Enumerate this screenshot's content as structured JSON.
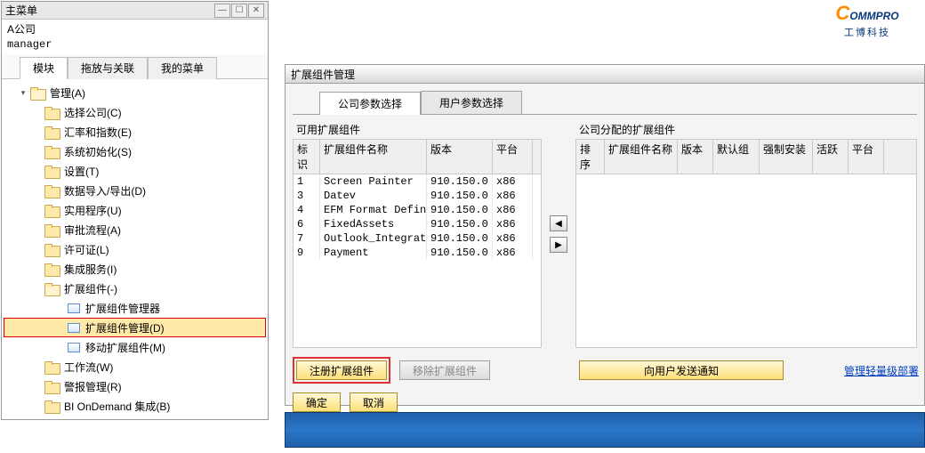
{
  "main_menu": {
    "title": "主菜单",
    "company": "A公司",
    "user": "manager",
    "tabs": [
      "模块",
      "拖放与关联",
      "我的菜单"
    ],
    "root": "管理(A)",
    "items": [
      "选择公司(C)",
      "汇率和指数(E)",
      "系统初始化(S)",
      "设置(T)",
      "数据导入/导出(D)",
      "实用程序(U)",
      "审批流程(A)",
      "许可证(L)",
      "集成服务(I)",
      "扩展组件(-)",
      "工作流(W)",
      "警报管理(R)",
      "BI OnDemand 集成(B)"
    ],
    "ext_children": [
      "扩展组件管理器",
      "扩展组件管理(D)",
      "移动扩展组件(M)"
    ]
  },
  "content": {
    "title": "扩展组件管理",
    "tabs": [
      "公司参数选择",
      "用户参数选择"
    ],
    "left": {
      "title": "可用扩展组件",
      "headers": [
        "标识",
        "扩展组件名称",
        "版本",
        "平台"
      ],
      "rows": [
        {
          "id": "1",
          "name": "Screen Painter",
          "ver": "910.150.0",
          "plat": "x86"
        },
        {
          "id": "3",
          "name": "Datev",
          "ver": "910.150.0",
          "plat": "x86"
        },
        {
          "id": "4",
          "name": "EFM Format Defini",
          "ver": "910.150.0",
          "plat": "x86"
        },
        {
          "id": "6",
          "name": "FixedAssets",
          "ver": "910.150.0",
          "plat": "x86"
        },
        {
          "id": "7",
          "name": "Outlook_Integrati",
          "ver": "910.150.0",
          "plat": "x86"
        },
        {
          "id": "9",
          "name": "Payment",
          "ver": "910.150.0",
          "plat": "x86"
        }
      ]
    },
    "right": {
      "title": "公司分配的扩展组件",
      "headers": [
        "排序",
        "扩展组件名称",
        "版本",
        "默认组",
        "强制安装",
        "活跃",
        "平台"
      ]
    },
    "buttons": {
      "register": "注册扩展组件",
      "remove": "移除扩展组件",
      "notify": "向用户发送通知",
      "ok": "确定",
      "cancel": "取消"
    },
    "link": "管理轻量级部署"
  },
  "logo": {
    "brand": "COMMPRO",
    "sub": "工博科技"
  }
}
